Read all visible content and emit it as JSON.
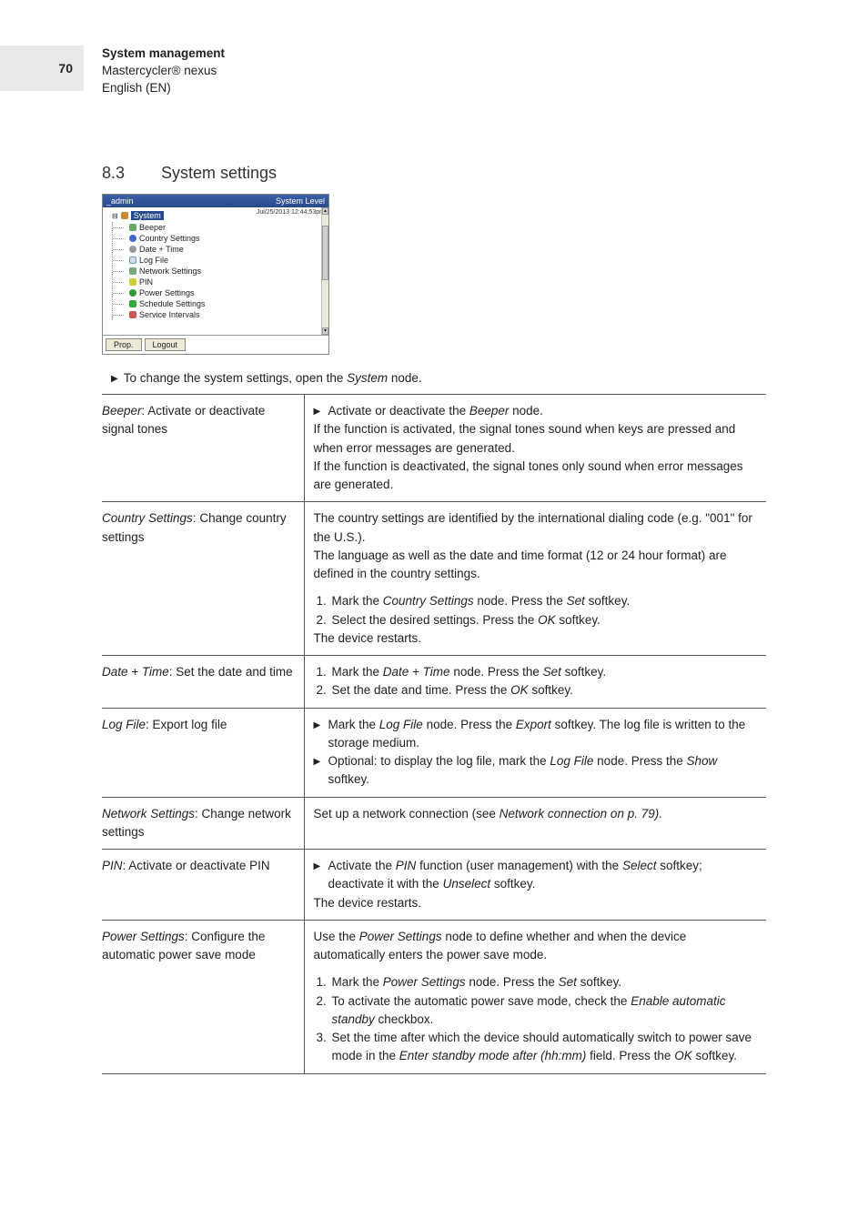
{
  "pageNumber": "70",
  "header": {
    "title": "System management",
    "product": "Mastercycler® nexus",
    "lang": "English (EN)"
  },
  "section": {
    "num": "8.3",
    "title": "System settings"
  },
  "screenshot": {
    "user": "_admin",
    "level": "System Level",
    "timestamp": "Jul/25/2013 12:44:53pm",
    "root": "System",
    "items": [
      "Beeper",
      "Country Settings",
      "Date + Time",
      "Log File",
      "Network Settings",
      "PIN",
      "Power Settings",
      "Schedule Settings",
      "Service Intervals"
    ],
    "btnProp": "Prop.",
    "btnLogout": "Logout"
  },
  "instruction": {
    "pre": "To change the system settings, open the ",
    "node": "System",
    "post": " node."
  },
  "rows": {
    "beeper": {
      "leftName": "Beeper",
      "leftRest": ": Activate or deactivate signal tones",
      "bulletPre": "Activate or deactivate the ",
      "bulletItalic": "Beeper",
      "bulletPost": " node.",
      "p1": "If the function is activated, the signal tones sound when keys are pressed and when error messages are generated.",
      "p2": "If the function is deactivated, the signal tones only sound when error messages are generated."
    },
    "country": {
      "leftName": "Country Settings",
      "leftRest": ": Change country settings",
      "p1": "The country settings are identified by the international dialing code (e.g. \"001\" for the U.S.).",
      "p2": "The language as well as the date and time format (12 or 24 hour format) are defined in the country settings.",
      "s1a": "Mark the ",
      "s1b": "Country Settings",
      "s1c": " node. Press the ",
      "s1d": "Set",
      "s1e": " softkey.",
      "s2a": "Select the desired settings. Press the ",
      "s2b": "OK",
      "s2c": " softkey.",
      "p3": "The device restarts."
    },
    "datetime": {
      "leftName": "Date + Time",
      "leftRest": ": Set the date and time",
      "s1a": "Mark the ",
      "s1b": "Date + Time",
      "s1c": " node. Press the ",
      "s1d": "Set",
      "s1e": " softkey.",
      "s2a": "Set the date and time. Press the ",
      "s2b": "OK",
      "s2c": " softkey."
    },
    "logfile": {
      "leftName": "Log File",
      "leftRest": ": Export log file",
      "b1a": "Mark the ",
      "b1b": "Log File",
      "b1c": " node. Press the ",
      "b1d": "Export",
      "b1e": " softkey. The log file is written to the storage medium.",
      "b2a": "Optional: to display the log file, mark the ",
      "b2b": "Log File",
      "b2c": " node. Press the ",
      "b2d": "Show",
      "b2e": " softkey."
    },
    "network": {
      "leftName": "Network Settings",
      "leftRest": ": Change network settings",
      "p1a": "Set up a network connection (see ",
      "p1b": "Network connection on p. 79).",
      "p1c": ""
    },
    "pin": {
      "leftName": "PIN",
      "leftRest": ": Activate or deactivate PIN",
      "b1a": "Activate the ",
      "b1b": "PIN",
      "b1c": " function (user management) with the ",
      "b1d": "Select",
      "b1e": " softkey; deactivate it with the ",
      "b1f": "Unselect",
      "b1g": " softkey.",
      "p2": "The device restarts."
    },
    "power": {
      "leftName": "Power Settings",
      "leftRest": ": Configure the automatic power save mode",
      "p1a": "Use the ",
      "p1b": "Power Settings",
      "p1c": " node to define whether and when the device automatically enters the power save mode.",
      "s1a": "Mark the ",
      "s1b": "Power Settings",
      "s1c": " node. Press the ",
      "s1d": "Set",
      "s1e": " softkey.",
      "s2a": "To activate the automatic power save mode, check the ",
      "s2b": "Enable automatic standby",
      "s2c": " checkbox.",
      "s3a": "Set the time after which the device should automatically switch to power save mode in the ",
      "s3b": "Enter standby mode after (hh:mm) ",
      "s3c": " field. Press the ",
      "s3d": "OK",
      "s3e": " softkey."
    }
  }
}
